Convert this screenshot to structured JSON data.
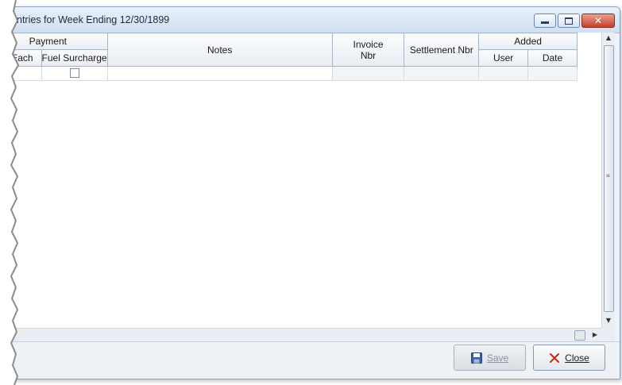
{
  "window": {
    "title": "ntries for Week Ending 12/30/1899"
  },
  "grid": {
    "group_headers": {
      "payment": "Payment",
      "added": "Added"
    },
    "columns": {
      "each": "Each",
      "fuel_surcharge": "Fuel Surcharge",
      "notes": "Notes",
      "invoice_nbr": "Invoice Nbr",
      "invoice_line1": "Invoice",
      "invoice_line2": "Nbr",
      "settlement_nbr": "Settlement Nbr",
      "user": "User",
      "date": "Date"
    },
    "rows": [
      {
        "each": "",
        "fuel_surcharge": false,
        "notes": "",
        "invoice_nbr": "",
        "settlement_nbr": "",
        "user": "",
        "date": ""
      }
    ]
  },
  "footer": {
    "save_label": "Save",
    "save_mnemonic": "S",
    "close_label": "Close",
    "close_mnemonic": "C"
  },
  "icons": {
    "save": "floppy-disk-icon",
    "close": "red-x-icon"
  },
  "colors": {
    "close_x": "#c62b14",
    "save_icon": "#3a5ea8"
  }
}
